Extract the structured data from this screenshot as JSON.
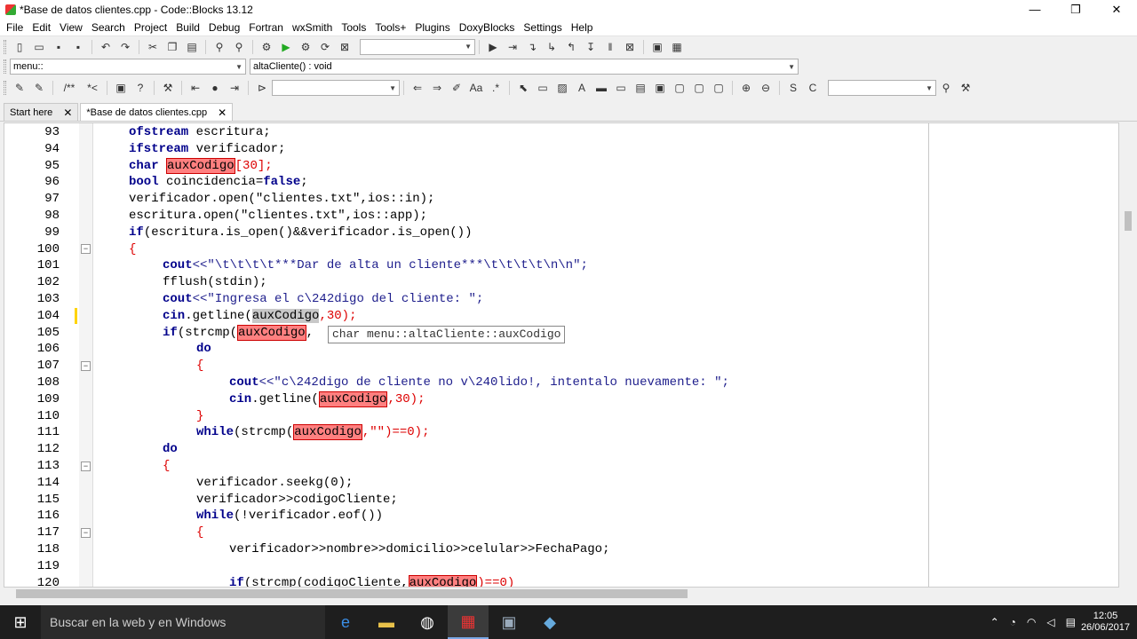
{
  "window": {
    "title": "*Base de datos clientes.cpp - Code::Blocks 13.12",
    "minimize": "—",
    "restore": "❐",
    "close": "✕"
  },
  "menu": [
    "File",
    "Edit",
    "View",
    "Search",
    "Project",
    "Build",
    "Debug",
    "Fortran",
    "wxSmith",
    "Tools",
    "Tools+",
    "Plugins",
    "DoxyBlocks",
    "Settings",
    "Help"
  ],
  "toolbar2": {
    "scope": "menu::",
    "function": "altaCliente() : void"
  },
  "tabs": [
    {
      "label": "Start here"
    },
    {
      "label": "*Base de datos clientes.cpp"
    }
  ],
  "tooltip": "char menu::altaCliente::auxCodigo",
  "lines": [
    {
      "n": "93"
    },
    {
      "n": "94"
    },
    {
      "n": "95"
    },
    {
      "n": "96"
    },
    {
      "n": "97"
    },
    {
      "n": "98"
    },
    {
      "n": "99"
    },
    {
      "n": "100"
    },
    {
      "n": "101"
    },
    {
      "n": "102"
    },
    {
      "n": "103"
    },
    {
      "n": "104"
    },
    {
      "n": "105"
    },
    {
      "n": "106"
    },
    {
      "n": "107"
    },
    {
      "n": "108"
    },
    {
      "n": "109"
    },
    {
      "n": "110"
    },
    {
      "n": "111"
    },
    {
      "n": "112"
    },
    {
      "n": "113"
    },
    {
      "n": "114"
    },
    {
      "n": "115"
    },
    {
      "n": "116"
    },
    {
      "n": "117"
    },
    {
      "n": "118"
    },
    {
      "n": "119"
    },
    {
      "n": "120"
    }
  ],
  "code": {
    "l93": [
      "ofstream",
      " escritura;"
    ],
    "l94": [
      "ifstream",
      " verificador;"
    ],
    "l95": [
      "char",
      " ",
      "auxCodigo",
      "[30];"
    ],
    "l96": [
      "bool",
      " coincidencia=",
      "false",
      ";"
    ],
    "l97": "verificador.open(\"clientes.txt\",ios::in);",
    "l98": "escritura.open(\"clientes.txt\",ios::app);",
    "l99": [
      "if",
      "(escritura.is_open()&&verificador.is_open())"
    ],
    "l100": "{",
    "l101": [
      "cout",
      "<<\"\\t\\t\\t\\t***Dar de alta un cliente***\\t\\t\\t\\t\\n\\n\";"
    ],
    "l102": "fflush(stdin);",
    "l103": [
      "cout",
      "<<\"Ingresa el c\\242digo del cliente: \";"
    ],
    "l104": [
      "cin",
      ".getline(",
      "auxCodigo",
      ",30);"
    ],
    "l105": [
      "if",
      "(strcmp(",
      "auxCodigo",
      ","
    ],
    "l106": "do",
    "l107": "{",
    "l108": [
      "cout",
      "<<\"c\\242digo de cliente no v\\240lido!, intentalo nuevamente: \";"
    ],
    "l109": [
      "cin",
      ".getline(",
      "auxCodigo",
      ",30);"
    ],
    "l110": "}",
    "l111": [
      "while",
      "(strcmp(",
      "auxCodigo",
      ",\"\")==0);"
    ],
    "l112": "do",
    "l113": "{",
    "l114": "verificador.seekg(0);",
    "l115": "verificador>>codigoCliente;",
    "l116": [
      "while",
      "(!verificador.eof())"
    ],
    "l117": "{",
    "l118": "verificador>>nombre>>domicilio>>celular>>FechaPago;",
    "l119": "",
    "l120": [
      "if",
      "(strcmp(codigoCliente,",
      "auxCodigo",
      ")==0)"
    ]
  },
  "taskbar": {
    "search": "Buscar en la web y en Windows",
    "time": "12:05",
    "date": "26/06/2017"
  }
}
